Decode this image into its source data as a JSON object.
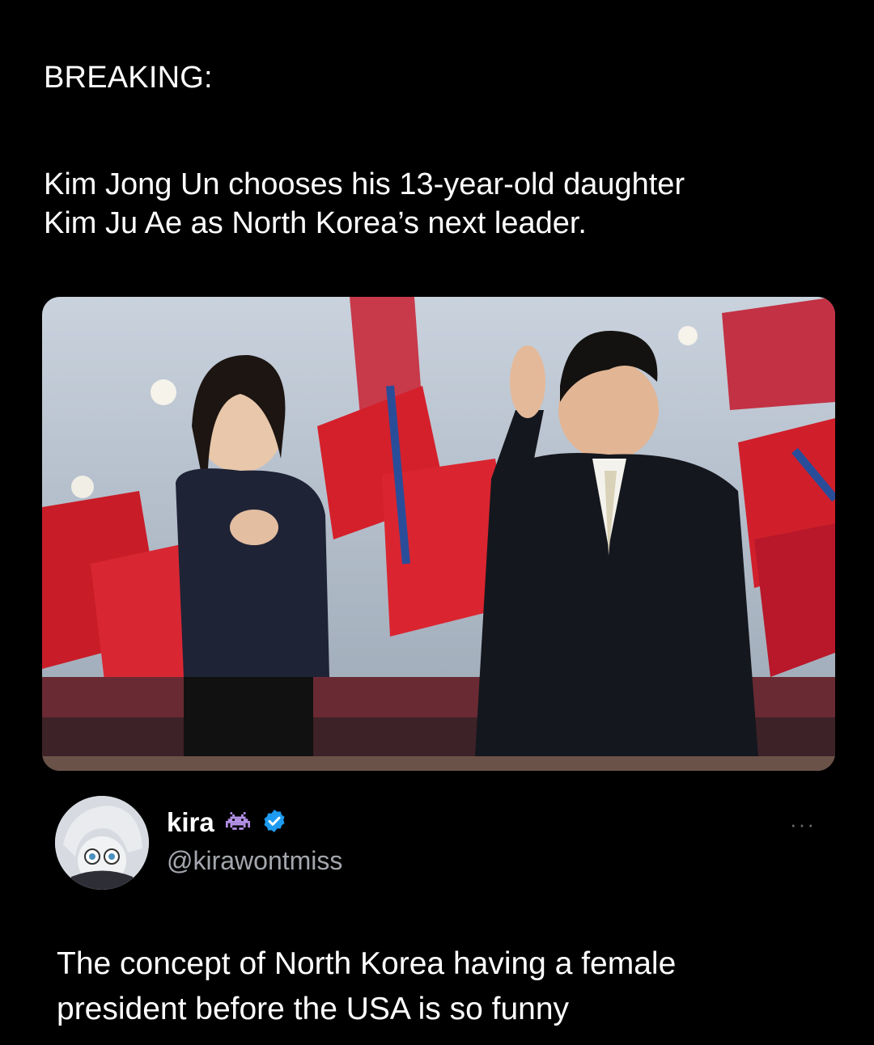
{
  "quoted": {
    "label": "BREAKING:",
    "headline_line1": "Kim Jong Un chooses his 13-year-old daughter",
    "headline_line2": "Kim Ju Ae as North Korea’s next leader."
  },
  "photo": {
    "icon": "photo-image",
    "colors": {
      "flag_red": "#d4202b",
      "sky": "#c7cfd9",
      "suit": "#16181f"
    }
  },
  "author": {
    "display_name": "kira",
    "handle": "@kirawontmiss",
    "badge_icon": "space-invader-icon",
    "verified_icon": "verified-check-icon",
    "verified_color": "#1d9bf0",
    "more_label": "···"
  },
  "tweet": {
    "line1": "The concept of North Korea having a female",
    "line2": "president before the USA is so funny"
  }
}
